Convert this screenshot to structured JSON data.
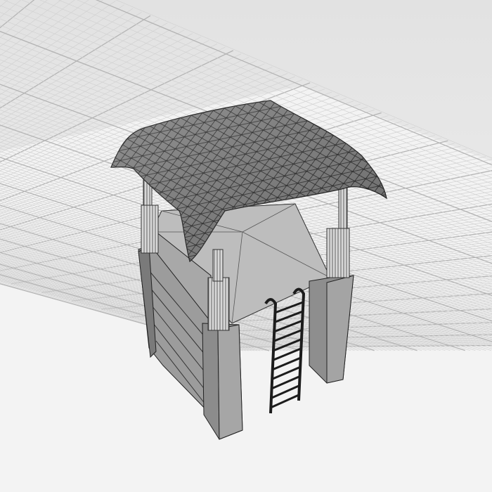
{
  "scene": {
    "subject": "watchtower-3d-model",
    "render_mode": "wireframe-shaded"
  },
  "colors": {
    "background_top": "#e3e3e3",
    "background_bottom": "#f2f2f2",
    "floor": "#f4f4f4",
    "grid_minor": "#d2d2d2",
    "grid_major": "#b4b4b4",
    "roof": "#7a7a7a",
    "wall": "#9a9a9a",
    "wall_dark": "#6e6e6e",
    "platform": "#b8b8b8",
    "ladder": "#2a2a2a"
  }
}
